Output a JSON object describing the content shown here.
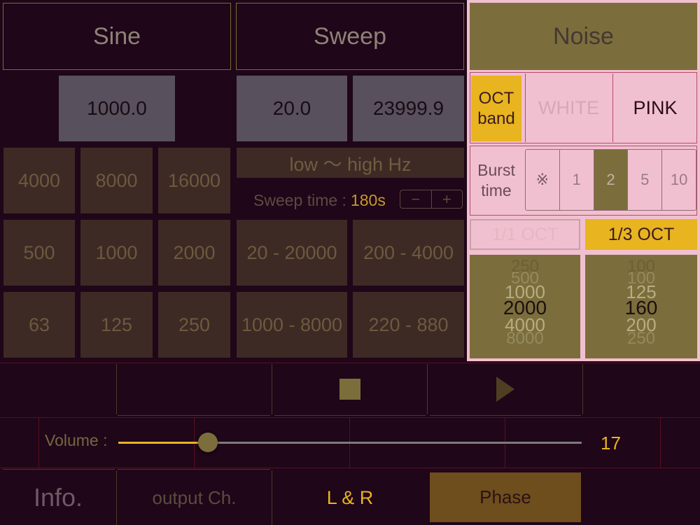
{
  "tabs": {
    "sine": "Sine",
    "sweep": "Sweep",
    "noise": "Noise"
  },
  "sine": {
    "frequency": "1000.0",
    "presets": [
      [
        "4000",
        "8000",
        "16000"
      ],
      [
        "500",
        "1000",
        "2000"
      ],
      [
        "63",
        "125",
        "250"
      ]
    ]
  },
  "sweep": {
    "start_freq": "20.0",
    "end_freq": "23999.9",
    "direction_label": "low 〜 high Hz",
    "time_label": "Sweep time :",
    "time_value": "180s",
    "minus": "−",
    "plus": "+",
    "presets": [
      [
        "20 - 20000",
        "200 - 4000"
      ],
      [
        "1000 - 8000",
        "220 - 880"
      ]
    ]
  },
  "noise": {
    "oct_band": "OCT\nband",
    "white": "WHITE",
    "pink": "PINK",
    "burst_label": "Burst\ntime",
    "burst_options": [
      "※",
      "1",
      "2",
      "5",
      "10"
    ],
    "burst_selected": "2",
    "oct_1_1": "1/1 OCT",
    "oct_1_3": "1/3 OCT",
    "picker_left": [
      "250",
      "500",
      "1000",
      "2000",
      "4000",
      "8000"
    ],
    "picker_left_selected": "2000",
    "picker_right": [
      "100",
      "100",
      "125",
      "160",
      "200",
      "250"
    ],
    "picker_right_selected": "160"
  },
  "transport": {
    "stop_icon": "stop-icon",
    "play_icon": "play-icon"
  },
  "volume": {
    "label": "Volume :",
    "value": "17",
    "level": 0.193
  },
  "bottom": {
    "info": "Info.",
    "output": "output Ch.",
    "channel": "L & R",
    "phase": "Phase"
  },
  "colors": {
    "accent": "#e8b41f",
    "olive": "#7b6e3c",
    "pink": "#f1c0d0",
    "bg": "#1f0618"
  }
}
